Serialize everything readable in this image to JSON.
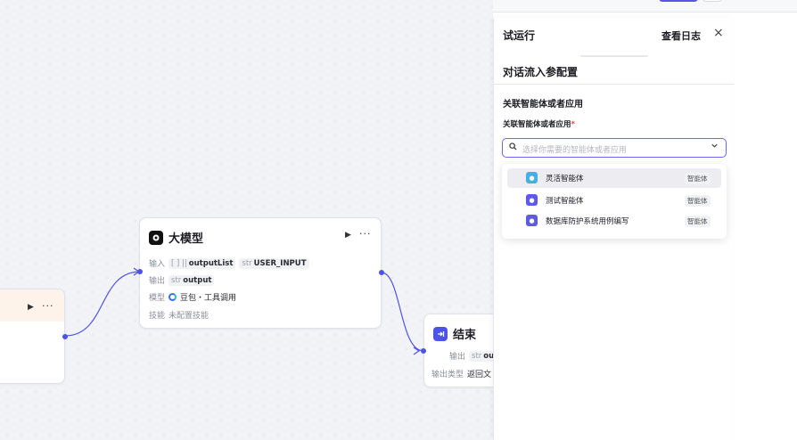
{
  "panel": {
    "title": "试运行",
    "log_button": "查看日志",
    "close_icon": "×",
    "section_title": "对话流入参配置",
    "assoc_heading": "关联智能体或者应用",
    "assoc_label": "关联智能体或者应用",
    "required_mark": "*",
    "select": {
      "placeholder": "选择你需要的智能体或者应用",
      "search_icon": "search-icon",
      "chevron_icon": "chevron-down-icon"
    },
    "options": [
      {
        "name": "灵活智能体",
        "badge": "智能体",
        "icon": "bot-icon",
        "color": "#3fb2e8",
        "selected": true
      },
      {
        "name": "测试智能体",
        "badge": "智能体",
        "icon": "bot-icon",
        "color": "#5e5ae8",
        "selected": false
      },
      {
        "name": "数据库防护系统用例编写",
        "badge": "智能体",
        "icon": "bot-icon",
        "color": "#5e5ae8",
        "selected": false
      }
    ]
  },
  "llm_node": {
    "title": "大模型",
    "icon": "llm-icon",
    "run_icon": "▶",
    "more_icon": "···",
    "input_label": "输入",
    "inputs": [
      {
        "type": "[ ] ||",
        "name": "outputList"
      },
      {
        "type": "str",
        "name": "USER_INPUT"
      }
    ],
    "output_label": "输出",
    "output": {
      "type": "str",
      "name": "output"
    },
    "model_label": "模型",
    "model_value": "豆包・工具调用",
    "skill_label": "技能",
    "skill_value": "未配置技能"
  },
  "start_node": {
    "run_icon": "▶",
    "more_icon": "···"
  },
  "end_node": {
    "title": "结束",
    "icon": "end-icon",
    "output_label": "输出",
    "output": {
      "type": "str",
      "name": "ou"
    },
    "output_type_label": "输出类型",
    "output_type_value": "返回文"
  },
  "colors": {
    "accent": "#4d53e8",
    "canvas_bg": "#f2f3f7",
    "start_header": "#fdf3ea"
  }
}
